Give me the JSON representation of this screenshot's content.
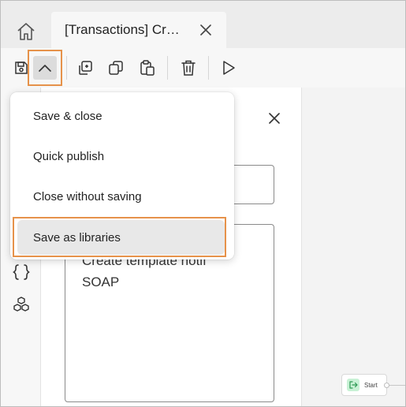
{
  "tab": {
    "title": "[Transactions] Cr…",
    "close_icon": "close-icon"
  },
  "home": {
    "icon": "home-icon"
  },
  "toolbar": {
    "icons": [
      "save-icon",
      "chevron-up-icon",
      "duplicate-icon",
      "copy-icon",
      "paste-icon",
      "delete-icon",
      "play-icon"
    ]
  },
  "menu": {
    "items": [
      {
        "label": "Save & close"
      },
      {
        "label": "Quick publish"
      },
      {
        "label": "Close without saving"
      },
      {
        "label": "Save as libraries"
      }
    ],
    "highlight_color": "#e6924a"
  },
  "panel": {
    "field1_value": "",
    "field2_value": "Create template notif\nSOAP"
  },
  "rail": {
    "icons": [
      "braces-icon",
      "cubes-icon"
    ]
  },
  "canvas": {
    "start_node_label": "Start"
  }
}
